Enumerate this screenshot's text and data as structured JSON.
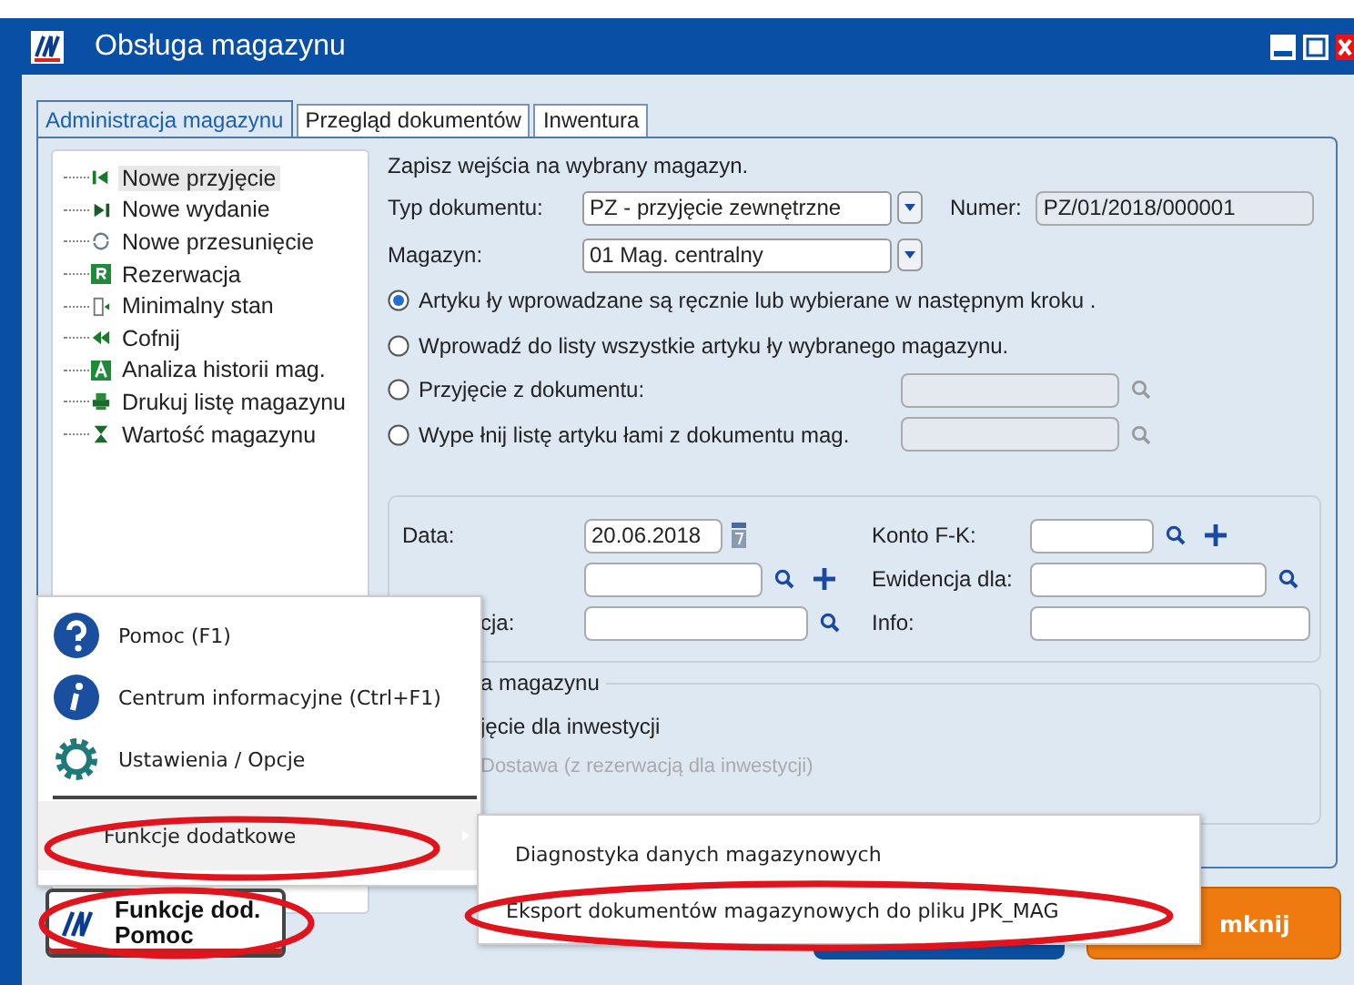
{
  "window": {
    "title": "Obsługa magazynu"
  },
  "tabs": [
    {
      "label": "Administracja magazynu",
      "selected": true
    },
    {
      "label": "Przegląd dokumentów",
      "selected": false
    },
    {
      "label": "Inwentura",
      "selected": false
    }
  ],
  "tree": [
    {
      "label": "Nowe przyjęcie",
      "kind": "first",
      "selected": true
    },
    {
      "label": "Nowe wydanie",
      "kind": "last",
      "selected": false
    },
    {
      "label": "Nowe przesunięcie",
      "kind": "move",
      "selected": false
    },
    {
      "label": "Rezerwacja",
      "kind": "letter_r",
      "selected": false
    },
    {
      "label": "Minimalny stan",
      "kind": "level",
      "selected": false
    },
    {
      "label": "Cofnij",
      "kind": "back",
      "selected": false
    },
    {
      "label": "Analiza historii mag.",
      "kind": "letter_a",
      "selected": false
    },
    {
      "label": "Drukuj listę magazynu",
      "kind": "print",
      "selected": false
    },
    {
      "label": "Wartość magazynu",
      "kind": "value",
      "selected": false
    }
  ],
  "intro": "Zapisz wejścia na wybrany magazyn.",
  "document_type": {
    "label": "Typ dokumentu:",
    "value": "PZ - przyjęcie zewnętrzne"
  },
  "number": {
    "label": "Numer:",
    "value": "PZ/01/2018/000001"
  },
  "warehouse": {
    "label": "Magazyn:",
    "value": "01 Mag. centralny"
  },
  "options": [
    {
      "label": "Artyku ły wprowadzane są ręcznie lub wybierane w następnym kroku .",
      "selected": true,
      "kind": "plain"
    },
    {
      "label": "Wprowadź do listy wszystkie artyku ły wybranego magazynu.",
      "selected": false,
      "kind": "plain"
    },
    {
      "label": "Przyjęcie z dokumentu:",
      "selected": false,
      "kind": "lookup"
    },
    {
      "label": "Wype łnij listę artyku łami z dokumentu mag.",
      "selected": false,
      "kind": "lookup"
    }
  ],
  "date": {
    "label": "Data:",
    "value": "20.06.2018"
  },
  "account": {
    "label": "Konto F-K:"
  },
  "register": {
    "label": "Ewidencja dla:"
  },
  "row_3": {
    "label": "cja:"
  },
  "info": {
    "label": "Info:"
  },
  "group": {
    "title": "a magazynu",
    "options": [
      {
        "label": "jęcie dla inwestycji",
        "disabled": false
      },
      {
        "label": "Dostawa (z rezerwacją dla inwestycji)",
        "disabled": true
      }
    ]
  },
  "close_button": {
    "label": "mknij"
  },
  "menu": {
    "items": [
      {
        "label": "Pomoc (F1)",
        "kind": "help",
        "selected": false
      },
      {
        "label": "Centrum informacyjne (Ctrl+F1)",
        "kind": "info",
        "selected": false
      },
      {
        "label": "Ustawienia / Opcje",
        "kind": "settings",
        "selected": false
      },
      {
        "label": "Funkcje dodatkowe",
        "kind": "submenu",
        "selected": true
      }
    ]
  },
  "submenu": {
    "items": [
      {
        "label": "Diagnostyka danych magazynowych"
      },
      {
        "label": "Eksport dokumentów magazynowych do pliku JPK_MAG"
      }
    ]
  },
  "menu_button": {
    "lines": [
      "Funkcje dod.",
      "Pomoc"
    ]
  }
}
